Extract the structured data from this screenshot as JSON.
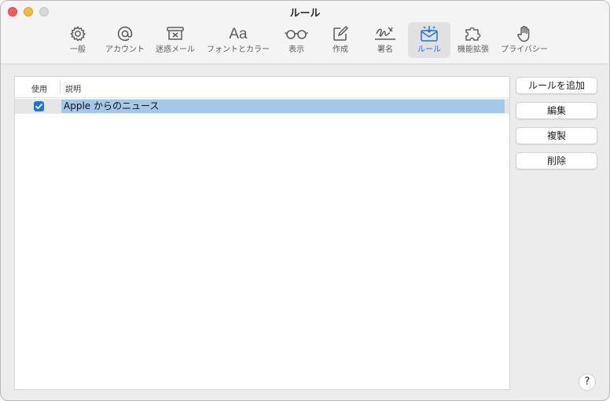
{
  "window": {
    "title": "ルール"
  },
  "toolbar": {
    "items": [
      {
        "label": "一般",
        "icon": "gear-icon"
      },
      {
        "label": "アカウント",
        "icon": "at-icon"
      },
      {
        "label": "迷惑メール",
        "icon": "junk-icon"
      },
      {
        "label": "フォントとカラー",
        "icon": "font-icon",
        "glyph": "Aa"
      },
      {
        "label": "表示",
        "icon": "glasses-icon"
      },
      {
        "label": "作成",
        "icon": "compose-icon"
      },
      {
        "label": "署名",
        "icon": "signature-icon"
      },
      {
        "label": "ルール",
        "icon": "rules-icon",
        "active": true
      },
      {
        "label": "機能拡張",
        "icon": "puzzle-icon"
      },
      {
        "label": "プライバシー",
        "icon": "hand-icon"
      }
    ],
    "active_color": "#1a73e8"
  },
  "table": {
    "headers": {
      "use": "使用",
      "description": "説明"
    },
    "rows": [
      {
        "enabled": true,
        "description": "Apple からのニュース"
      }
    ]
  },
  "buttons": {
    "add": "ルールを追加",
    "edit": "編集",
    "duplicate": "複製",
    "delete": "削除",
    "help": "?"
  }
}
